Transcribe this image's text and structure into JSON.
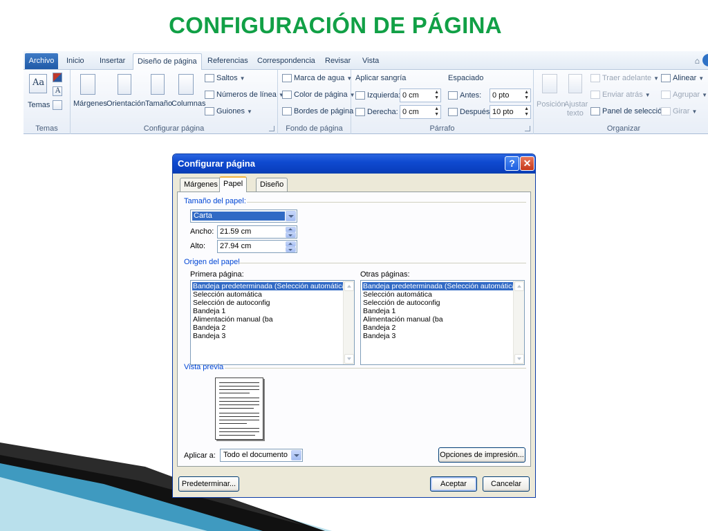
{
  "slide": {
    "title": "CONFIGURACIÓN DE PÁGINA"
  },
  "ribbon": {
    "tabs": [
      "Archivo",
      "Inicio",
      "Insertar",
      "Diseño de página",
      "Referencias",
      "Correspondencia",
      "Revisar",
      "Vista"
    ],
    "active_tab": "Diseño de página",
    "groups": {
      "temas": {
        "label": "Temas",
        "temas_button": "Temas"
      },
      "configurar_pagina": {
        "label": "Configurar página",
        "margenes": "Márgenes",
        "orientacion": "Orientación",
        "tamano": "Tamaño",
        "columnas": "Columnas",
        "saltos": "Saltos",
        "numeros_linea": "Números de línea",
        "guiones": "Guiones"
      },
      "fondo_pagina": {
        "label": "Fondo de página",
        "marca_agua": "Marca de agua",
        "color_pagina": "Color de página",
        "bordes_pagina": "Bordes de página"
      },
      "parrafo": {
        "label": "Párrafo",
        "aplicar_sangria": "Aplicar sangría",
        "izquierda_label": "Izquierda:",
        "izquierda_value": "0 cm",
        "derecha_label": "Derecha:",
        "derecha_value": "0 cm",
        "espaciado": "Espaciado",
        "antes_label": "Antes:",
        "antes_value": "0 pto",
        "despues_label": "Después:",
        "despues_value": "10 pto"
      },
      "organizar": {
        "label": "Organizar",
        "posicion": "Posición",
        "ajustar_texto_1": "Ajustar",
        "ajustar_texto_2": "texto",
        "traer_adelante": "Traer adelante",
        "enviar_atras": "Enviar atrás",
        "panel_seleccion": "Panel de selección",
        "alinear": "Alinear",
        "agrupar": "Agrupar",
        "girar": "Girar"
      }
    }
  },
  "dialog": {
    "title": "Configurar página",
    "help": "?",
    "close": "✕",
    "tabs": [
      "Márgenes",
      "Papel",
      "Diseño"
    ],
    "active_tab": "Papel",
    "paper_size": {
      "section": "Tamaño del papel:",
      "selected": "Carta",
      "ancho_label": "Ancho:",
      "ancho_value": "21.59 cm",
      "alto_label": "Alto:",
      "alto_value": "27.94 cm"
    },
    "paper_source": {
      "section": "Origen del papel",
      "first_page_label": "Primera página:",
      "other_pages_label": "Otras páginas:",
      "items": [
        "Bandeja predeterminada (Selección automática)",
        "Selección automática",
        "Selección de autoconfig",
        "Bandeja 1",
        "Alimentación manual (ba",
        "Bandeja 2",
        "Bandeja 3"
      ],
      "selected_index": 0
    },
    "preview": {
      "section": "Vista previa",
      "apply_label": "Aplicar a:",
      "apply_value": "Todo el documento",
      "print_options": "Opciones de impresión..."
    },
    "buttons": {
      "default": "Predeterminar...",
      "ok": "Aceptar",
      "cancel": "Cancelar"
    }
  }
}
